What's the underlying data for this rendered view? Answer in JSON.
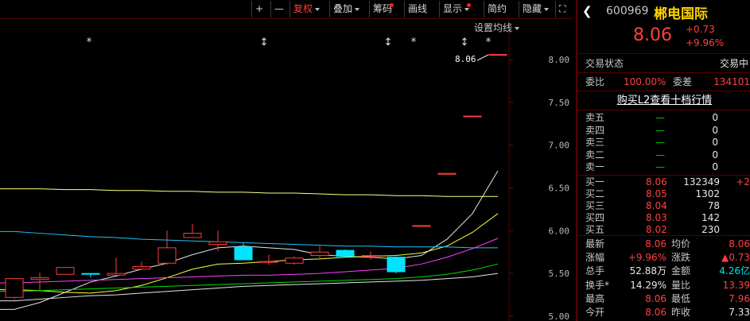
{
  "toolbar": {
    "items": [
      {
        "name": "plus",
        "label": "+"
      },
      {
        "name": "minus",
        "label": "—"
      },
      {
        "name": "fuquan",
        "label": "复权",
        "arrow": true,
        "active": true
      },
      {
        "name": "diejia",
        "label": "叠加",
        "arrow": true
      },
      {
        "name": "chouma",
        "label": "筹码",
        "dot": true
      },
      {
        "name": "huaxian",
        "label": "画线"
      },
      {
        "name": "xianshi",
        "label": "显示",
        "arrow": true,
        "dot": true
      },
      {
        "name": "jianyue",
        "label": "简约"
      },
      {
        "name": "yincang",
        "label": "隐藏",
        "arrow": true
      },
      {
        "name": "fullscreen",
        "label": "⛶"
      }
    ],
    "settings_label": "设置均线"
  },
  "chart_data": {
    "type": "candlestick",
    "ylim": [
      5.0,
      8.0
    ],
    "y_ticks": [
      "8.00",
      "7.50",
      "7.00",
      "6.50",
      "6.00",
      "5.50",
      "5.00"
    ],
    "price_annotation": "8.06",
    "markers": [
      "*",
      "↕",
      "↕",
      "*",
      "↕",
      "*"
    ],
    "candles": [
      {
        "open": 5.22,
        "close": 5.44,
        "high": 5.44,
        "low": 5.2
      },
      {
        "open": 5.43,
        "close": 5.45,
        "high": 5.51,
        "low": 5.3
      },
      {
        "open": 5.49,
        "close": 5.57,
        "high": 5.57,
        "low": 5.49
      },
      {
        "open": 5.5,
        "close": 5.49,
        "high": 5.5,
        "low": 5.45
      },
      {
        "open": 5.48,
        "close": 5.5,
        "high": 5.68,
        "low": 5.48
      },
      {
        "open": 5.55,
        "close": 5.58,
        "high": 5.64,
        "low": 5.54
      },
      {
        "open": 5.62,
        "close": 5.8,
        "high": 6.0,
        "low": 5.6
      },
      {
        "open": 5.92,
        "close": 5.97,
        "high": 6.08,
        "low": 5.92
      },
      {
        "open": 5.84,
        "close": 5.87,
        "high": 6.0,
        "low": 5.76
      },
      {
        "open": 5.81,
        "close": 5.66,
        "high": 5.86,
        "low": 5.66
      },
      {
        "open": 5.63,
        "close": 5.64,
        "high": 5.72,
        "low": 5.6
      },
      {
        "open": 5.62,
        "close": 5.68,
        "high": 5.7,
        "low": 5.6
      },
      {
        "open": 5.71,
        "close": 5.75,
        "high": 5.82,
        "low": 5.66
      },
      {
        "open": 5.77,
        "close": 5.7,
        "high": 5.78,
        "low": 5.7
      },
      {
        "open": 5.7,
        "close": 5.71,
        "high": 5.76,
        "low": 5.66
      },
      {
        "open": 5.69,
        "close": 5.52,
        "high": 5.7,
        "low": 5.5
      },
      {
        "open": 6.05,
        "close": 6.06,
        "high": 6.06,
        "low": 6.05
      },
      {
        "open": 6.66,
        "close": 6.67,
        "high": 6.67,
        "low": 6.66
      },
      {
        "open": 7.33,
        "close": 7.34,
        "high": 7.34,
        "low": 7.33
      },
      {
        "open": 8.05,
        "close": 8.06,
        "high": 8.06,
        "low": 8.05
      }
    ],
    "moving_averages": [
      {
        "color": "#e6e6e6",
        "values": [
          5.08,
          5.16,
          5.28,
          5.4,
          5.47,
          5.55,
          5.62,
          5.72,
          5.8,
          5.82,
          5.8,
          5.78,
          5.72,
          5.7,
          5.69,
          5.67,
          5.71,
          5.9,
          6.2,
          6.7
        ]
      },
      {
        "color": "#ffff40",
        "values": [
          5.31,
          5.3,
          5.28,
          5.27,
          5.3,
          5.36,
          5.45,
          5.55,
          5.61,
          5.62,
          5.64,
          5.66,
          5.67,
          5.69,
          5.7,
          5.71,
          5.74,
          5.82,
          5.98,
          6.2
        ]
      },
      {
        "color": "#ff40ff",
        "values": [
          5.39,
          5.4,
          5.41,
          5.42,
          5.43,
          5.44,
          5.45,
          5.46,
          5.47,
          5.48,
          5.48,
          5.49,
          5.5,
          5.52,
          5.54,
          5.56,
          5.61,
          5.69,
          5.79,
          5.91
        ]
      },
      {
        "color": "#00e000",
        "values": [
          5.29,
          5.3,
          5.31,
          5.32,
          5.33,
          5.34,
          5.35,
          5.36,
          5.37,
          5.38,
          5.39,
          5.4,
          5.41,
          5.42,
          5.43,
          5.44,
          5.46,
          5.49,
          5.54,
          5.61
        ]
      },
      {
        "color": "#e6e6e6",
        "values": [
          5.18,
          5.2,
          5.22,
          5.24,
          5.25,
          5.27,
          5.29,
          5.31,
          5.33,
          5.35,
          5.36,
          5.37,
          5.38,
          5.39,
          5.4,
          5.41,
          5.42,
          5.44,
          5.46,
          5.5
        ]
      },
      {
        "color": "#20c0ff",
        "values": [
          5.99,
          5.97,
          5.95,
          5.93,
          5.92,
          5.9,
          5.89,
          5.88,
          5.87,
          5.86,
          5.85,
          5.84,
          5.83,
          5.82,
          5.82,
          5.81,
          5.81,
          5.81,
          5.8,
          5.8
        ]
      },
      {
        "color": "#ffff80",
        "values": [
          6.49,
          6.49,
          6.48,
          6.48,
          6.47,
          6.47,
          6.46,
          6.46,
          6.45,
          6.45,
          6.44,
          6.44,
          6.43,
          6.42,
          6.42,
          6.41,
          6.41,
          6.4,
          6.4,
          6.4
        ]
      }
    ]
  },
  "quote": {
    "code": "600969",
    "name": "郴电国际",
    "price": "8.06",
    "change": "+0.73",
    "change_pct": "+9.96%",
    "status_label": "交易状态",
    "status_value": "交易中",
    "weibi_label": "委比",
    "weibi_value": "100.00%",
    "weicha_label": "委差",
    "weicha_value": "134101",
    "l2_link": "购买L2查看十档行情",
    "asks": [
      {
        "label": "卖五",
        "price": "—",
        "vol": "0"
      },
      {
        "label": "卖四",
        "price": "—",
        "vol": "0"
      },
      {
        "label": "卖三",
        "price": "—",
        "vol": "0"
      },
      {
        "label": "卖二",
        "price": "—",
        "vol": "0"
      },
      {
        "label": "卖一",
        "price": "—",
        "vol": "0"
      }
    ],
    "bids": [
      {
        "label": "买一",
        "price": "8.06",
        "vol": "132349",
        "delta": "+2"
      },
      {
        "label": "买二",
        "price": "8.05",
        "vol": "1302",
        "delta": ""
      },
      {
        "label": "买三",
        "price": "8.04",
        "vol": "78",
        "delta": ""
      },
      {
        "label": "买四",
        "price": "8.03",
        "vol": "142",
        "delta": ""
      },
      {
        "label": "买五",
        "price": "8.02",
        "vol": "230",
        "delta": ""
      }
    ],
    "stats": [
      {
        "l1": "最新",
        "v1": "8.06",
        "c1": "red",
        "l2": "均价",
        "v2": "8.06",
        "c2": "red"
      },
      {
        "l1": "涨幅",
        "v1": "+9.96%",
        "c1": "red",
        "l2": "涨跌",
        "v2": "▲0.73",
        "c2": "red"
      },
      {
        "l1": "总手",
        "v1": "52.88万",
        "c1": "white",
        "l2": "金额",
        "v2": "4.26亿",
        "c2": "cyan"
      },
      {
        "l1": "换手*",
        "v1": "14.29%",
        "c1": "white",
        "l2": "量比",
        "v2": "13.39",
        "c2": "red"
      },
      {
        "l1": "最高",
        "v1": "8.06",
        "c1": "red",
        "l2": "最低",
        "v2": "7.96",
        "c2": "red"
      },
      {
        "l1": "今开",
        "v1": "8.06",
        "c1": "red",
        "l2": "昨收",
        "v2": "7.33",
        "c2": "white"
      }
    ]
  }
}
